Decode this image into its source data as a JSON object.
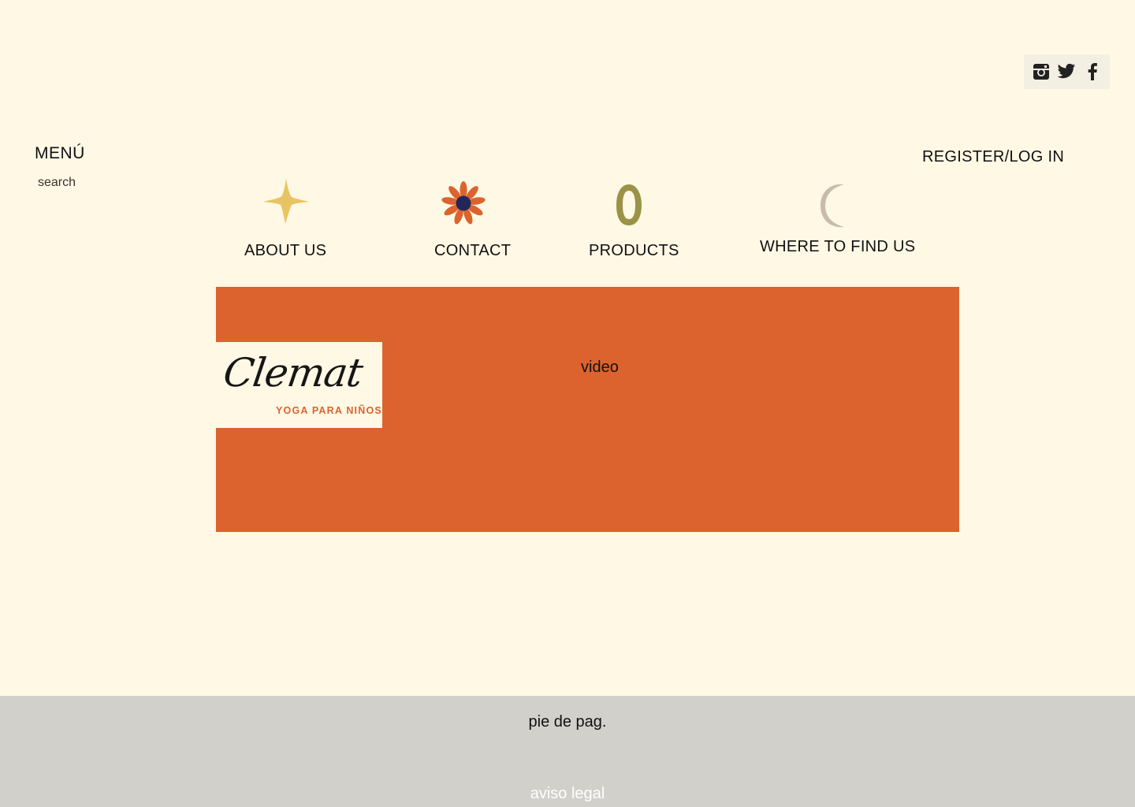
{
  "social": {
    "icons": [
      "instagram-icon",
      "twitter-icon",
      "facebook-icon"
    ]
  },
  "header": {
    "menu_label": "MENÚ",
    "search_label": "search",
    "register_label": "REGISTER/LOG IN"
  },
  "nav": {
    "about": {
      "label": "ABOUT US",
      "icon": "star-icon",
      "color": "#E8C462"
    },
    "contact": {
      "label": "CONTACT",
      "icon": "flower-icon",
      "color": "#DC632D"
    },
    "products": {
      "label": "PRODUCTS",
      "icon": "ring-icon",
      "color": "#9A9347"
    },
    "where": {
      "label": "WHERE TO FIND US",
      "icon": "moon-icon",
      "color": "#C8BBA8"
    }
  },
  "hero": {
    "video_label": "video",
    "logo": {
      "name": "Clemat",
      "tagline": "YOGA PARA NIÑOS"
    },
    "background": "#DC632D"
  },
  "footer": {
    "title": "pie de pag.",
    "legal_link": "aviso legal"
  },
  "colors": {
    "page_bg": "#FFF8E5",
    "accent": "#DC632D",
    "footer_bg": "#D1D0CA"
  }
}
